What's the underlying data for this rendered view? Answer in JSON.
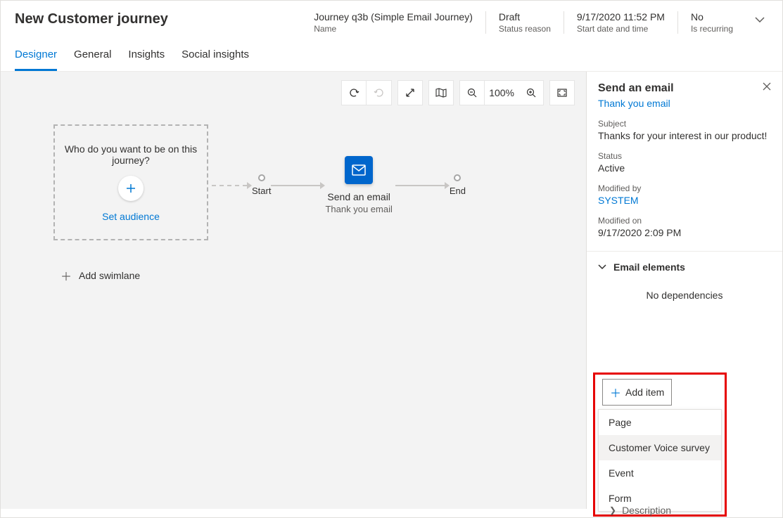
{
  "header": {
    "title": "New Customer journey",
    "fields": [
      {
        "value": "Journey q3b (Simple Email Journey)",
        "label": "Name"
      },
      {
        "value": "Draft",
        "label": "Status reason"
      },
      {
        "value": "9/17/2020 11:52 PM",
        "label": "Start date and time"
      },
      {
        "value": "No",
        "label": "Is recurring"
      }
    ]
  },
  "tabs": [
    "Designer",
    "General",
    "Insights",
    "Social insights"
  ],
  "toolbar": {
    "zoom": "100%"
  },
  "canvas": {
    "audience_question": "Who do you want to be on this journey?",
    "set_audience": "Set audience",
    "start_label": "Start",
    "end_label": "End",
    "email_title": "Send an email",
    "email_subtitle": "Thank you email",
    "add_swimlane": "Add swimlane"
  },
  "panel": {
    "title": "Send an email",
    "link": "Thank you email",
    "subject_label": "Subject",
    "subject_value": "Thanks for your interest in our product!",
    "status_label": "Status",
    "status_value": "Active",
    "modifiedby_label": "Modified by",
    "modifiedby_value": "SYSTEM",
    "modifiedon_label": "Modified on",
    "modifiedon_value": "9/17/2020 2:09 PM",
    "section_title": "Email elements",
    "no_deps": "No dependencies",
    "add_item": "Add item",
    "dropdown": [
      "Page",
      "Customer Voice survey",
      "Event",
      "Form"
    ],
    "description_label": "Description"
  }
}
